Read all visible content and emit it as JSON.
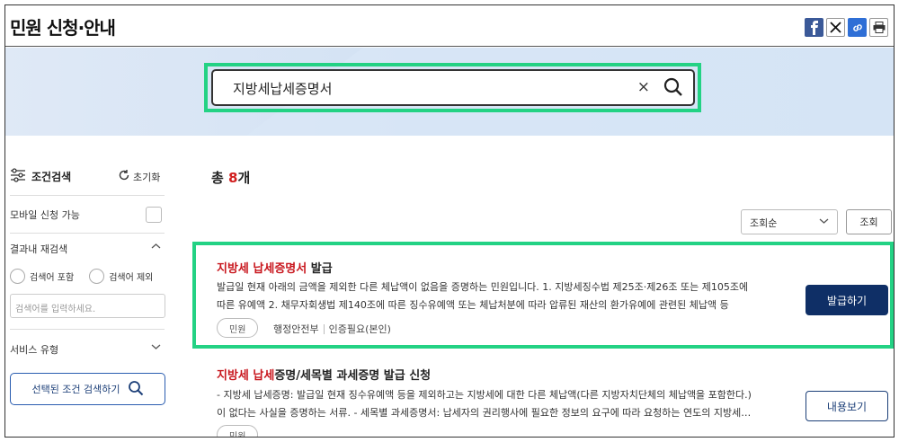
{
  "header": {
    "title": "민원 신청·안내",
    "share_icons": [
      "facebook-icon",
      "x-icon",
      "link-icon",
      "print-icon"
    ]
  },
  "search": {
    "value": "지방세납세증명서",
    "clear_glyph": "×"
  },
  "sidebar": {
    "filter_title": "조건검색",
    "reset_label": "초기화",
    "mobile_label": "모바일 신청 가능",
    "research_label": "결과내 재검색",
    "include_label": "검색어 포함",
    "exclude_label": "검색어 제외",
    "input_placeholder": "검색어를 입력하세요.",
    "service_type_label": "서비스 유형",
    "apply_label": "선택된 조건 검색하기"
  },
  "results": {
    "total_prefix": "총 ",
    "total_count": "8",
    "total_suffix": "개",
    "sort_value": "조회순",
    "query_label": "조회",
    "items": [
      {
        "title_highlight": "지방세 납세증명서",
        "title_rest": " 발급",
        "desc_line1": "발급일 현재 아래의 금액을 제외한 다른 체납액이 없음을 증명하는 민원입니다. 1. 지방세징수법 제25조·제26조 또는 제105조에",
        "desc_line2": "따른 유예액 2. 채무자회생법 제140조에 따른 징수유예액 또는 체납처분에 따라 압류된 재산의 환가유예에 관련된 체납액 등",
        "tag": "민원",
        "agency": "행정안전부",
        "auth": "인증필요(본인)",
        "button": "발급하기"
      },
      {
        "title_highlight": "지방세 납세",
        "title_rest": "증명/세목별 과세증명 발급 신청",
        "desc_line1": "- 지방세 납세증명: 발급일 현재 징수유예액 등을 제외하고는 지방세에 대한 다른 체납액(다른 지방자치단체의 체납액을 포함한다.)",
        "desc_line2": "이 없다는 사실을 증명하는 서류. - 세목별 과세증명서: 납세자의 권리행사에 필요한 정보의 요구에 따라 요청하는 연도의 지방세…",
        "tag": "민원",
        "button": "내용보기"
      }
    ]
  },
  "colors": {
    "highlight_outline": "#23d284",
    "primary_button": "#0f2f66",
    "accent_red": "#d11e1e"
  }
}
